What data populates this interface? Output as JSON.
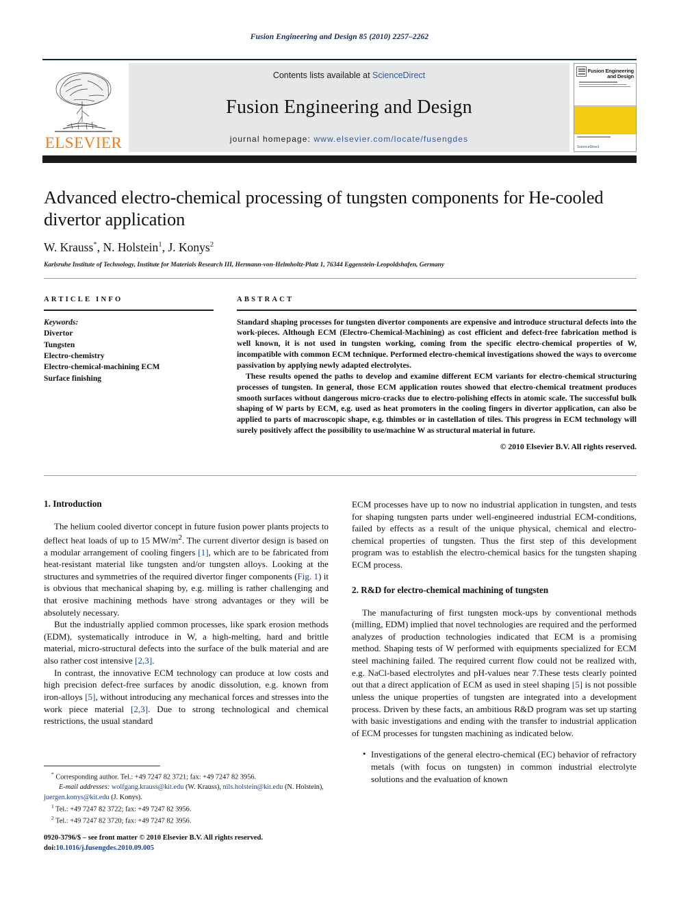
{
  "running_head": "Fusion Engineering and Design 85 (2010) 2257–2262",
  "masthead": {
    "publisher_name": "ELSEVIER",
    "contents_prefix": "Contents lists available at ",
    "contents_link": "ScienceDirect",
    "journal_title": "Fusion Engineering and Design",
    "homepage_prefix": "journal homepage: ",
    "homepage_url": "www.elsevier.com/locate/fusengdes",
    "cover": {
      "title_line1": "Fusion Engineering",
      "title_line2": "and Design",
      "sciencedirect_label": "ScienceDirect"
    }
  },
  "article": {
    "title": "Advanced electro-chemical processing of tungsten components for He-cooled divertor application",
    "authors": "W. Krauss",
    "author_2": ", N. Holstein",
    "author_3": ", J. Konys",
    "author_mark_1": "*",
    "author_mark_2": "1",
    "author_mark_3": "2",
    "affiliation": "Karlsruhe Institute of Technology, Institute for Materials Research III, Hermann-von-Helmholtz-Platz 1, 76344 Eggenstein-Leopoldshafen, Germany"
  },
  "article_info": {
    "label": "ARTICLE INFO",
    "keywords_label": "Keywords:",
    "keywords": [
      "Divertor",
      "Tungsten",
      "Electro-chemistry",
      "Electro-chemical-machining ECM",
      "Surface finishing"
    ]
  },
  "abstract": {
    "label": "ABSTRACT",
    "paragraph_1": "Standard shaping processes for tungsten divertor components are expensive and introduce structural defects into the work-pieces. Although ECM (Electro-Chemical-Machining) as cost efficient and defect-free fabrication method is well known, it is not used in tungsten working, coming from the specific electro-chemical properties of W, incompatible with common ECM technique. Performed electro-chemical investigations showed the ways to overcome passivation by applying newly adapted electrolytes.",
    "paragraph_2": "These results opened the paths to develop and examine different ECM variants for electro-chemical structuring processes of tungsten. In general, those ECM application routes showed that electro-chemical treatment produces smooth surfaces without dangerous micro-cracks due to electro-polishing effects in atomic scale. The successful bulk shaping of W parts by ECM, e.g. used as heat promoters in the cooling fingers in divertor application, can also be applied to parts of macroscopic shape, e.g. thimbles or in castellation of tiles. This progress in ECM technology will surely positively affect the possibility to use/machine W as structural material in future.",
    "copyright": "© 2010 Elsevier B.V. All rights reserved."
  },
  "sections": {
    "intro_heading": "1.  Introduction",
    "intro_p1_a": "The helium cooled divertor concept in future fusion power plants projects to deflect heat loads of up to 15 MW/m",
    "intro_p1_sup": "2",
    "intro_p1_b": ". The current divertor design is based on a modular arrangement of cooling fingers ",
    "intro_p1_cite1": "[1]",
    "intro_p1_c": ", which are to be fabricated from heat-resistant material like tungsten and/or tungsten alloys. Looking at the structures and symmetries of the required divertor finger components (",
    "intro_p1_cite2": "Fig. 1",
    "intro_p1_d": ") it is obvious that mechanical shaping by, e.g. milling is rather challenging and that erosive machining methods have strong advantages or they will be absolutely necessary.",
    "intro_p2_a": "But the industrially applied common processes, like spark erosion methods (EDM), systematically introduce in W, a high-melting, hard and brittle material, micro-structural defects into the surface of the bulk material and are also rather cost intensive ",
    "intro_p2_cite": "[2,3]",
    "intro_p2_b": ".",
    "intro_p3_a": "In contrast, the innovative ECM technology can produce at low costs and high precision defect-free surfaces by anodic dissolution, e.g. known from iron-alloys ",
    "intro_p3_cite1": "[5]",
    "intro_p3_b": ", without introducing any mechanical forces and stresses into the work piece material ",
    "intro_p3_cite2": "[2,3]",
    "intro_p3_c": ". Due to strong technological and chemical restrictions, the usual standard",
    "right_p1": "ECM processes have up to now no industrial application in tungsten, and tests for shaping tungsten parts under well-engineered industrial ECM-conditions, failed by effects as a result of the unique physical, chemical and electro-chemical properties of tungsten. Thus the first step of this development program was to establish the electro-chemical basics for the tungsten shaping ECM process.",
    "rd_heading": "2.  R&D for electro-chemical machining of tungsten",
    "rd_p1_a": "The manufacturing of first tungsten mock-ups by conventional methods (milling, EDM) implied that novel technologies are required and the performed analyzes of production technologies indicated that ECM is a promising method. Shaping tests of W performed with equipments specialized for ECM steel machining failed. The required current flow could not be realized with, e.g. NaCl-based electrolytes and pH-values near 7.These tests clearly pointed out that a direct application of ECM as used in steel shaping ",
    "rd_p1_cite": "[5]",
    "rd_p1_b": " is not possible unless the unique properties of tungsten are integrated into a development process. Driven by these facts, an ambitious R&D program was set up starting with basic investigations and ending with the transfer to industrial application of ECM processes for tungsten machining as indicated below.",
    "bullet_1": "Investigations of the general electro-chemical (EC) behavior of refractory metals (with focus on tungsten) in common industrial electrolyte solutions and the evaluation of known"
  },
  "footnotes": {
    "corresponding_mark": "*",
    "corresponding": " Corresponding author. Tel.: +49 7247 82 3721; fax: +49 7247 82 3956.",
    "email_label": "E-mail addresses:",
    "email_1": "wolfgang.krauss@kit.edu",
    "email_1_owner": " (W. Krauss), ",
    "email_2": "nils.holstein@kit.edu",
    "email_2_owner": " (N. Holstein), ",
    "email_3": "juergen.konys@kit.edu",
    "email_3_owner": " (J. Konys).",
    "tel_1_mark": "1",
    "tel_1": " Tel.: +49 7247 82 3722; fax: +49 7247 82 3956.",
    "tel_2_mark": "2",
    "tel_2": " Tel.: +49 7247 82 3720; fax: +49 7247 82 3956."
  },
  "footer": {
    "issn_line": "0920-3796/$ – see front matter © 2010 Elsevier B.V. All rights reserved.",
    "doi_prefix": "doi:",
    "doi_value": "10.1016/j.fusengdes.2010.09.005"
  },
  "colors": {
    "link_blue": "#2b57a6",
    "cite_blue": "#1c3f94",
    "elsevier_orange": "#f07d18",
    "cover_yellow": "#f5cc12",
    "banner_gray": "#e6e7e9",
    "rule_dark": "#1b1b1b"
  }
}
